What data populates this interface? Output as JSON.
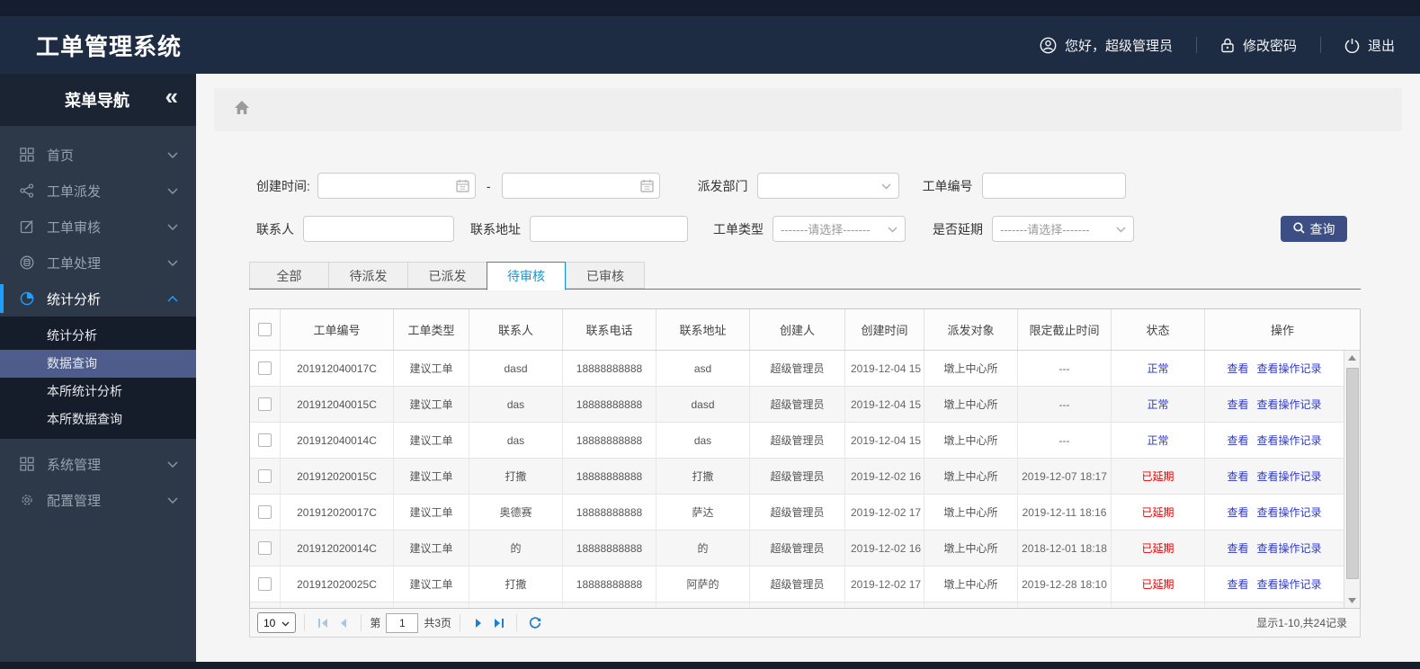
{
  "app": {
    "title": "工单管理系统"
  },
  "header": {
    "greeting": "您好，超级管理员",
    "change_password": "修改密码",
    "logout": "退出"
  },
  "sidebar": {
    "title": "菜单导航",
    "collapse_glyph": "«",
    "items": [
      {
        "label": "首页"
      },
      {
        "label": "工单派发"
      },
      {
        "label": "工单审核"
      },
      {
        "label": "工单处理"
      },
      {
        "label": "统计分析"
      },
      {
        "label": "系统管理"
      },
      {
        "label": "配置管理"
      }
    ],
    "submenu": [
      {
        "label": "统计分析"
      },
      {
        "label": "数据查询"
      },
      {
        "label": "本所统计分析"
      },
      {
        "label": "本所数据查询"
      }
    ]
  },
  "filters": {
    "created_time_label": "创建时间:",
    "range_separator": "-",
    "dispatch_dept_label": "派发部门",
    "order_no_label": "工单编号",
    "contact_label": "联系人",
    "address_label": "联系地址",
    "order_type_label": "工单类型",
    "delayed_label": "是否延期",
    "select_placeholder": "-------请选择-------",
    "search_button": "查询"
  },
  "tabs": [
    {
      "label": "全部"
    },
    {
      "label": "待派发"
    },
    {
      "label": "已派发"
    },
    {
      "label": "待审核",
      "active": true
    },
    {
      "label": "已审核"
    }
  ],
  "table": {
    "columns": [
      "工单编号",
      "工单类型",
      "联系人",
      "联系电话",
      "联系地址",
      "创建人",
      "创建时间",
      "派发对象",
      "限定截止时间",
      "状态",
      "操作"
    ],
    "action_labels": {
      "view": "查看",
      "view_log": "查看操作记录"
    },
    "rows": [
      {
        "order_no": "201912040017C",
        "type": "建议工单",
        "contact": "dasd",
        "phone": "18888888888",
        "address": "asd",
        "creator": "超级管理员",
        "created": "2019-12-04 15",
        "dispatch_to": "墩上中心所",
        "deadline": "---",
        "status": "正常",
        "status_color": "blue"
      },
      {
        "order_no": "201912040015C",
        "type": "建议工单",
        "contact": "das",
        "phone": "18888888888",
        "address": "dasd",
        "creator": "超级管理员",
        "created": "2019-12-04 15",
        "dispatch_to": "墩上中心所",
        "deadline": "---",
        "status": "正常",
        "status_color": "blue"
      },
      {
        "order_no": "201912040014C",
        "type": "建议工单",
        "contact": "das",
        "phone": "18888888888",
        "address": "das",
        "creator": "超级管理员",
        "created": "2019-12-04 15",
        "dispatch_to": "墩上中心所",
        "deadline": "---",
        "status": "正常",
        "status_color": "blue"
      },
      {
        "order_no": "201912020015C",
        "type": "建议工单",
        "contact": "打撒",
        "phone": "18888888888",
        "address": "打撒",
        "creator": "超级管理员",
        "created": "2019-12-02 16",
        "dispatch_to": "墩上中心所",
        "deadline": "2019-12-07 18:17",
        "status": "已延期",
        "status_color": "red"
      },
      {
        "order_no": "201912020017C",
        "type": "建议工单",
        "contact": "奥德赛",
        "phone": "18888888888",
        "address": "萨达",
        "creator": "超级管理员",
        "created": "2019-12-02 17",
        "dispatch_to": "墩上中心所",
        "deadline": "2019-12-11 18:16",
        "status": "已延期",
        "status_color": "red"
      },
      {
        "order_no": "201912020014C",
        "type": "建议工单",
        "contact": "的",
        "phone": "18888888888",
        "address": "的",
        "creator": "超级管理员",
        "created": "2019-12-02 16",
        "dispatch_to": "墩上中心所",
        "deadline": "2018-12-01 18:18",
        "status": "已延期",
        "status_color": "red"
      },
      {
        "order_no": "201912020025C",
        "type": "建议工单",
        "contact": "打撒",
        "phone": "18888888888",
        "address": "阿萨的",
        "creator": "超级管理员",
        "created": "2019-12-02 17",
        "dispatch_to": "墩上中心所",
        "deadline": "2019-12-28 18:10",
        "status": "已延期",
        "status_color": "red"
      }
    ]
  },
  "pagination": {
    "page_size": "10",
    "page_prefix": "第",
    "current_page": "1",
    "total_pages": "共3页",
    "summary": "显示1-10,共24记录"
  },
  "colors": {
    "header_navy": "#1e2c43",
    "sidebar_dark": "#2d3848",
    "accent_blue": "#1e9fff",
    "tab_blue": "#1794d2",
    "button_navy": "#3d4e85",
    "link_blue": "#2f3ac9",
    "status_blue": "#2b36c8",
    "status_red": "#e60000"
  }
}
